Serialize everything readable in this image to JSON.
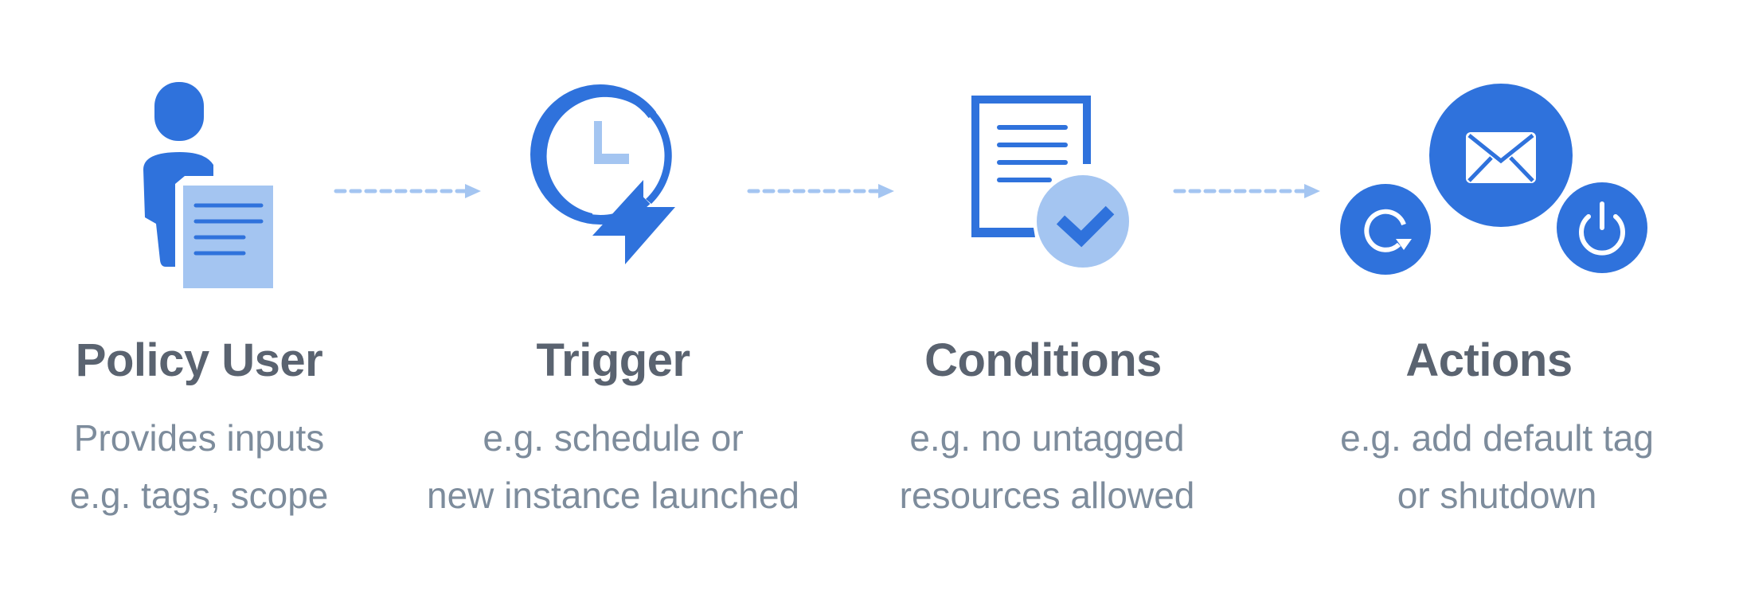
{
  "colors": {
    "primary": "#2F72DC",
    "light": "#A4C5F1",
    "title": "#5A6370",
    "description": "#7D8C9C",
    "arrow": "#A4C5F1"
  },
  "steps": [
    {
      "icon": "user-with-document-icon",
      "title": "Policy User",
      "lines": [
        "Provides inputs",
        "e.g. tags, scope"
      ]
    },
    {
      "icon": "clock-lightning-icon",
      "title": "Trigger",
      "lines": [
        "e.g. schedule or",
        "new instance launched"
      ]
    },
    {
      "icon": "document-check-icon",
      "title": "Conditions",
      "lines": [
        "e.g. no untagged",
        "resources allowed"
      ]
    },
    {
      "icon": "actions-icon",
      "title": "Actions",
      "lines": [
        "e.g. add default tag",
        "or shutdown"
      ]
    }
  ]
}
